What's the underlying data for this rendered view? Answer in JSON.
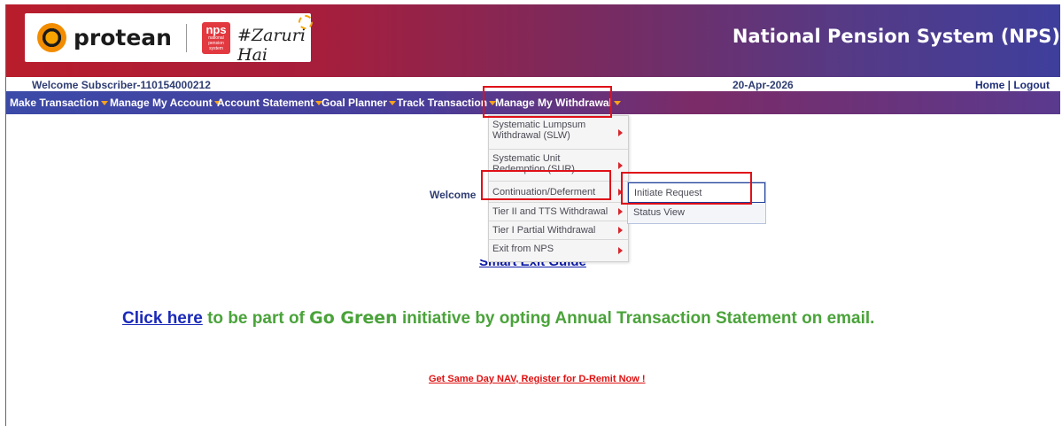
{
  "brand": {
    "name": "protean",
    "nps_logo_top": "nps",
    "nps_logo_sub": "national pension system",
    "tagline": "#Zaruri Hai"
  },
  "header": {
    "title": "National Pension System (NPS)"
  },
  "strip": {
    "welcome": "Welcome Subscriber-110154000212",
    "date": "20-Apr-2026",
    "home": "Home",
    "sep": " | ",
    "logout": "Logout"
  },
  "nav": {
    "items": [
      {
        "label": "Make Transaction"
      },
      {
        "label": "Manage My Account"
      },
      {
        "label": "Account Statement"
      },
      {
        "label": "Goal Planner"
      },
      {
        "label": "Track Transaction"
      },
      {
        "label": "Manage My Withdrawal"
      }
    ]
  },
  "dropdown": {
    "items": [
      {
        "label": "Systematic Lumpsum Withdrawal (SLW)"
      },
      {
        "label": "Systematic Unit Redemption (SUR)"
      },
      {
        "label": "Continuation/Deferment"
      },
      {
        "label": "Tier II and TTS Withdrawal"
      },
      {
        "label": "Tier I Partial Withdrawal"
      },
      {
        "label": "Exit from NPS"
      }
    ]
  },
  "submenu": {
    "items": [
      {
        "label": "Initiate Request"
      },
      {
        "label": "Status View"
      }
    ]
  },
  "main": {
    "welcome": "Welcome",
    "exit_guide": "Smart Exit Guide",
    "gogreen": {
      "link": "Click here",
      "part1": " to be part of ",
      "highlight": "Go Green",
      "part2": " initiative by opting Annual Transaction Statement on email."
    },
    "dremit": "Get Same Day NAV, Register for D-Remit Now !"
  },
  "colors": {
    "highlight": "#e01018",
    "nav_caret": "#f7a21b",
    "gogreen": "#4aa33a"
  }
}
